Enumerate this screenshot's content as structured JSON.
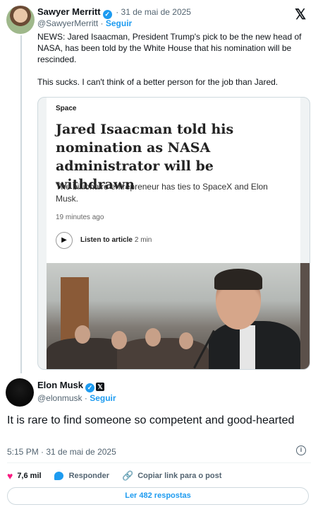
{
  "quoted_tweet": {
    "name": "Sawyer Merritt",
    "date": "· 31 de mai de 2025",
    "handle": "@SawyerMerritt",
    "separator": " · ",
    "follow": "Seguir",
    "text_1": "NEWS: Jared Isaacman, President Trump's pick to be the new head of NASA, has been told by the White House that his nomination will be rescinded.",
    "text_2": "This sucks. I can't think of a better person for the job than Jared.",
    "card": {
      "section": "Space",
      "title": "Jared Isaacman told his nomination as NASA administrator will be withdrawn",
      "subtitle": "The billionaire entrepreneur has ties to SpaceX and Elon Musk.",
      "time": "19 minutes ago",
      "listen_label": "Listen to article",
      "listen_duration": "2 min"
    }
  },
  "reply_tweet": {
    "name": "Elon Musk",
    "handle": "@elonmusk",
    "separator": " · ",
    "follow": "Seguir",
    "text": "It is rare to find someone so competent and good-hearted",
    "timestamp": "5:15 PM · 31 de mai de 2025",
    "likes": "7,6 mil",
    "reply_label": "Responder",
    "copy_link_label": "Copiar link para o post",
    "read_replies": "Ler 482 respostas"
  },
  "icons": {
    "x_logo": "𝕏",
    "verified": "✓",
    "x_badge": "𝕏",
    "heart": "♥",
    "link": "🔗",
    "play": "▶",
    "info": "i"
  },
  "colors": {
    "accent": "#1d9bf0",
    "heart": "#f91880",
    "muted": "#536471"
  }
}
